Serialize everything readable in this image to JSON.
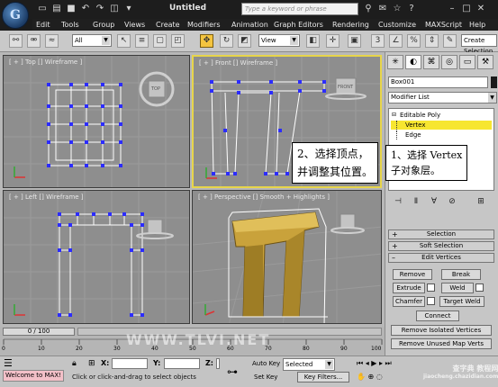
{
  "window": {
    "title": "Untitled",
    "search_placeholder": "Type a keyword or phrase",
    "logo": "G"
  },
  "menu": [
    "Edit",
    "Tools",
    "Group",
    "Views",
    "Create",
    "Modifiers",
    "Animation",
    "Graph Editors",
    "Rendering",
    "Customize",
    "MAXScript",
    "Help"
  ],
  "toolbar": {
    "selection_filter": "All",
    "reference_coord": "View",
    "create_selection_set": "Create Selection Se"
  },
  "viewports": {
    "top": "[ + ] Top [] Wireframe ]",
    "front": "[ + ] Front [] Wireframe ]",
    "left": "[ + ] Left [] Wireframe ]",
    "perspective": "[ + ] Perspective [] Smooth + Highlights ]",
    "viewcube_top": "TOP",
    "viewcube_front": "FRONT",
    "viewcube_left": "LEFT"
  },
  "callouts": {
    "vertex_adjust_1": "2、选择顶点，",
    "vertex_adjust_2": "并调整其位置。",
    "vertex_subobject_1": "1、选择 Vertex",
    "vertex_subobject_2": "子对象层。"
  },
  "command_panel": {
    "object_name": "Box001",
    "modifier_list": "Modifier List",
    "stack": [
      "Editable Poly",
      "Vertex",
      "Edge"
    ],
    "rollouts": {
      "selection": "Selection",
      "soft_selection": "Soft Selection",
      "edit_vertices": "Edit Vertices"
    },
    "buttons": {
      "remove": "Remove",
      "break": "Break",
      "extrude": "Extrude",
      "weld": "Weld",
      "chamfer": "Chamfer",
      "target_weld": "Target Weld",
      "connect": "Connect",
      "remove_isolated": "Remove Isolated Vertices",
      "remove_unused": "Remove Unused Map Verts"
    }
  },
  "timeline": {
    "frame_range": "0 / 100",
    "ticks": [
      "0",
      "10",
      "20",
      "30",
      "40",
      "50",
      "60",
      "70",
      "80",
      "90",
      "100"
    ]
  },
  "status": {
    "maxscript": "Welcome to MAX!",
    "prompt": "Click or click-and-drag to select objects",
    "x_label": "X:",
    "y_label": "Y:",
    "z_label": "Z:",
    "auto_key": "Auto Key",
    "set_key": "Set Key",
    "key_mode": "Selected",
    "key_filters": "Key Filters..."
  },
  "watermark": "WWW.TLVI.NET",
  "watermark_site": "查字典 教程网",
  "watermark_url": "jiaocheng.chazidian.com",
  "colors": {
    "active_viewport_border": "#e7d54a",
    "selected_stack": "#f7e630",
    "vertex": "#2c2cff",
    "object_fill": "#c9a23b"
  }
}
